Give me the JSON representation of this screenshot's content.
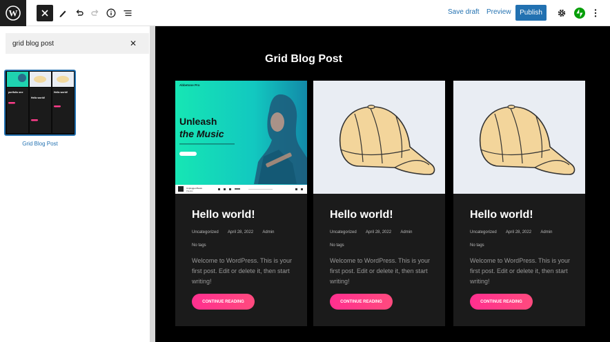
{
  "toolbar": {
    "save_draft": "Save draft",
    "preview": "Preview",
    "publish": "Publish",
    "icons": [
      "wordpress-logo-icon",
      "close-icon",
      "pencil-icon",
      "undo-icon",
      "redo-icon",
      "info-icon",
      "list-view-icon",
      "gear-icon",
      "jetpack-icon",
      "more-vertical-icon"
    ],
    "accent_color": "#2271b1",
    "jetpack_color": "#069e08"
  },
  "sidebar": {
    "search_value": "grid blog post",
    "pattern_label": "Grid Blog Post",
    "thumb": {
      "hero_line1": "Unleash",
      "hero_line2": "the Music",
      "post_title": "Hello world!",
      "post_title_alt": "Things About Business Going",
      "post_title_short": "portfolio one"
    }
  },
  "canvas": {
    "title": "Grid Blog Post",
    "hero": {
      "brand": "Abbetone Pro",
      "line1": "Unleash",
      "line2": "the Music",
      "player_title": "Unplugged Beats",
      "player_sub": "Playlist"
    },
    "posts": [
      {
        "title": "Hello world!",
        "category": "Uncategorized",
        "date": "April 28, 2022",
        "author": "Admin",
        "tags": "No tags",
        "excerpt": "Welcome to WordPress. This is your first post. Edit or delete it, then start writing!",
        "button": "CONTINUE READING"
      },
      {
        "title": "Hello world!",
        "category": "Uncategorized",
        "date": "April 28, 2022",
        "author": "Admin",
        "tags": "No tags",
        "excerpt": "Welcome to WordPress. This is your first post. Edit or delete it, then start writing!",
        "button": "CONTINUE READING"
      },
      {
        "title": "Hello world!",
        "category": "Uncategorized",
        "date": "April 28, 2022",
        "author": "Admin",
        "tags": "No tags",
        "excerpt": "Welcome to WordPress. This is your first post. Edit or delete it, then start writing!",
        "button": "CONTINUE READING"
      }
    ]
  }
}
